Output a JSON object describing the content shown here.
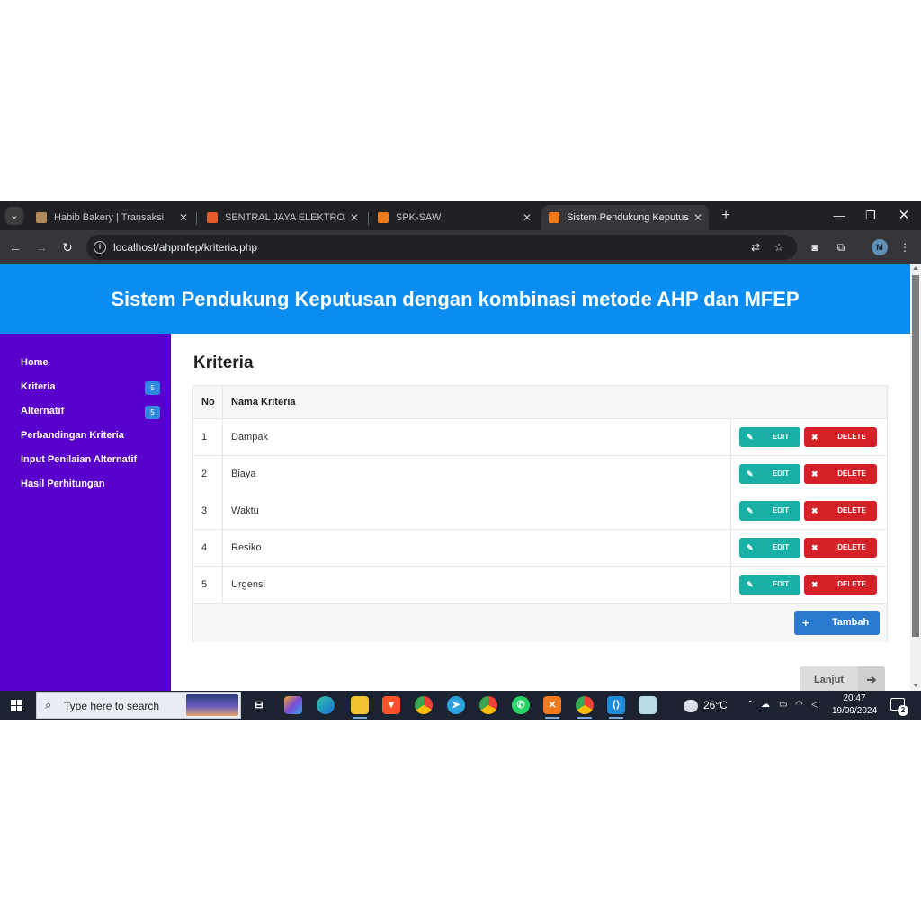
{
  "browser": {
    "tabs": [
      {
        "label": "Habib Bakery | Transaksi",
        "color": "#b08a5a"
      },
      {
        "label": "SENTRAL JAYA ELEKTRONIK | Ho",
        "color": "#e25b2a"
      },
      {
        "label": "SPK-SAW",
        "color": "#f07a1a"
      },
      {
        "label": "Sistem Pendukung Keputusan m",
        "color": "#f07a1a"
      }
    ],
    "url": "localhost/ahpmfep/kriteria.php"
  },
  "page": {
    "header_title": "Sistem Pendukung Keputusan dengan kombinasi metode AHP dan MFEP",
    "sidebar": [
      {
        "label": "Home"
      },
      {
        "label": "Kriteria",
        "badge": "5"
      },
      {
        "label": "Alternatif",
        "badge": "5"
      },
      {
        "label": "Perbandingan Kriteria"
      },
      {
        "label": "Input Penilaian Alternatif"
      },
      {
        "label": "Hasil Perhitungan"
      }
    ],
    "content_title": "Kriteria",
    "table": {
      "headers": [
        "No",
        "Nama Kriteria"
      ],
      "rows": [
        {
          "no": "1",
          "nama": "Dampak"
        },
        {
          "no": "2",
          "nama": "Biaya"
        },
        {
          "no": "3",
          "nama": "Waktu"
        },
        {
          "no": "4",
          "nama": "Resiko"
        },
        {
          "no": "5",
          "nama": "Urgensi"
        }
      ],
      "edit_label": "EDIT",
      "delete_label": "DELETE"
    },
    "tambah_label": "Tambah",
    "lanjut_label": "Lanjut",
    "colors": {
      "header": "#0a8cf0",
      "sidebar": "#5a00cc",
      "edit": "#19b0a8",
      "delete": "#d42127",
      "tambah": "#2a7ad0"
    }
  },
  "taskbar": {
    "search_placeholder": "Type here to search",
    "temperature": "26°C",
    "time": "20:47",
    "date": "19/09/2024",
    "notification_count": "2"
  }
}
